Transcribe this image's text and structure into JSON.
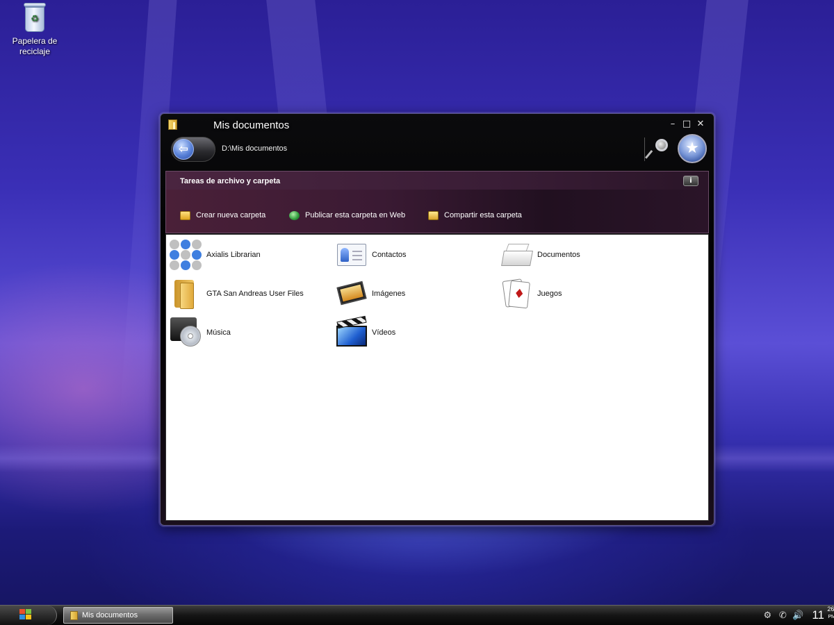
{
  "desktop": {
    "icons": [
      {
        "label": "Papelera de reciclaje",
        "icon": "recycle-bin-icon"
      }
    ]
  },
  "window": {
    "title": "Mis documentos",
    "address": "D:\\Mis documentos",
    "controls": {
      "minimize": "–",
      "maximize": "□",
      "close": "✕"
    },
    "tasks": {
      "title": "Tareas de archivo y carpeta",
      "info_label": "i",
      "items": [
        {
          "label": "Crear nueva carpeta",
          "icon": "new-folder-icon"
        },
        {
          "label": "Publicar esta carpeta en Web",
          "icon": "globe-icon"
        },
        {
          "label": "Compartir esta carpeta",
          "icon": "share-folder-icon"
        }
      ]
    },
    "items": [
      {
        "label": "Axialis Librarian",
        "icon": "axialis-librarian-icon"
      },
      {
        "label": "Contactos",
        "icon": "contacts-icon"
      },
      {
        "label": "Documentos",
        "icon": "documents-icon"
      },
      {
        "label": "GTA San Andreas User Files",
        "icon": "folder-icon"
      },
      {
        "label": "Imágenes",
        "icon": "images-icon"
      },
      {
        "label": "Juegos",
        "icon": "cards-icon"
      },
      {
        "label": "Música",
        "icon": "music-cd-icon"
      },
      {
        "label": "Vídeos",
        "icon": "video-clapper-icon"
      }
    ]
  },
  "taskbar": {
    "open_window": "Mis documentos",
    "clock": {
      "hour": "11",
      "minute": "26",
      "ampm": "PM"
    }
  },
  "colors": {
    "tasks_panel": "#3a1a33",
    "window_chrome": "#000000",
    "accent_blue": "#5a82d8"
  }
}
